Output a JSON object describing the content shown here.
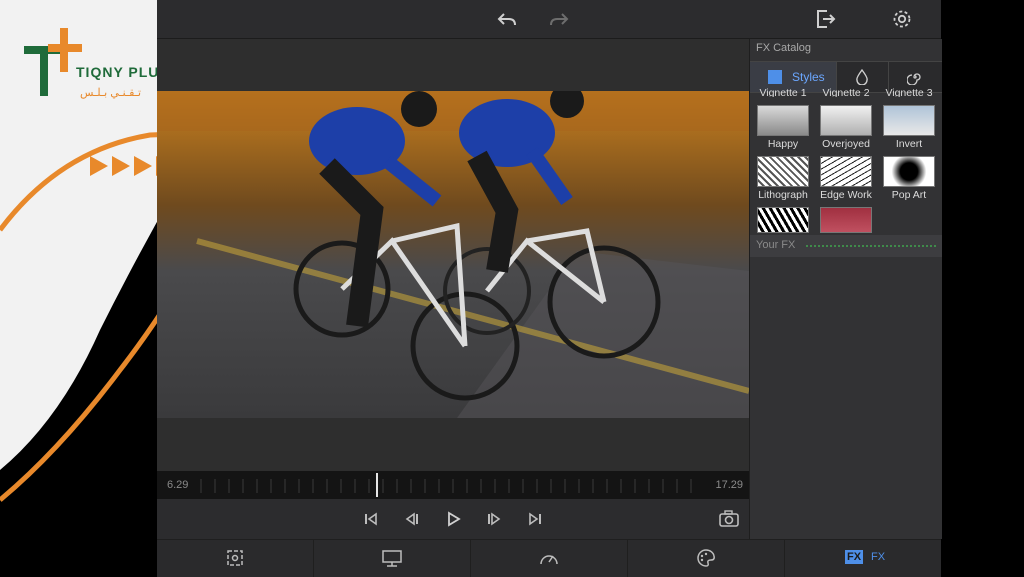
{
  "brand": {
    "logo_text": "TIQNY PLUS",
    "logo_subtext": "تـقـنـي بـلـس",
    "primary_color": "#1f6b3a",
    "accent_color": "#e8892b"
  },
  "toolbar": {
    "undo_icon": "undo-icon",
    "redo_icon": "redo-icon",
    "export_icon": "export-icon",
    "settings_icon": "gear-icon"
  },
  "timeline": {
    "start_time": "6.29",
    "end_time": "17.29",
    "playhead_fraction": 0.37
  },
  "fx_panel": {
    "title": "FX Catalog",
    "tabs": [
      {
        "label": "Styles",
        "icon": "styles-icon",
        "selected": true
      },
      {
        "label": "",
        "icon": "drop-icon",
        "selected": false
      },
      {
        "label": "",
        "icon": "spiral-icon",
        "selected": false
      }
    ],
    "partial_row_labels": [
      "Vignette 1",
      "Vignette 2",
      "Vignette 3"
    ],
    "items": [
      {
        "label": "Happy"
      },
      {
        "label": "Overjoyed"
      },
      {
        "label": "Invert"
      },
      {
        "label": "Lithograph"
      },
      {
        "label": "Edge Work"
      },
      {
        "label": "Pop Art"
      }
    ],
    "your_fx_label": "Your FX"
  },
  "bottom_tabs": [
    {
      "icon": "crop-icon",
      "label": ""
    },
    {
      "icon": "display-icon",
      "label": ""
    },
    {
      "icon": "speed-icon",
      "label": ""
    },
    {
      "icon": "palette-icon",
      "label": ""
    },
    {
      "icon": "fx-icon",
      "label": "FX",
      "badge": "FX",
      "selected": true
    }
  ]
}
